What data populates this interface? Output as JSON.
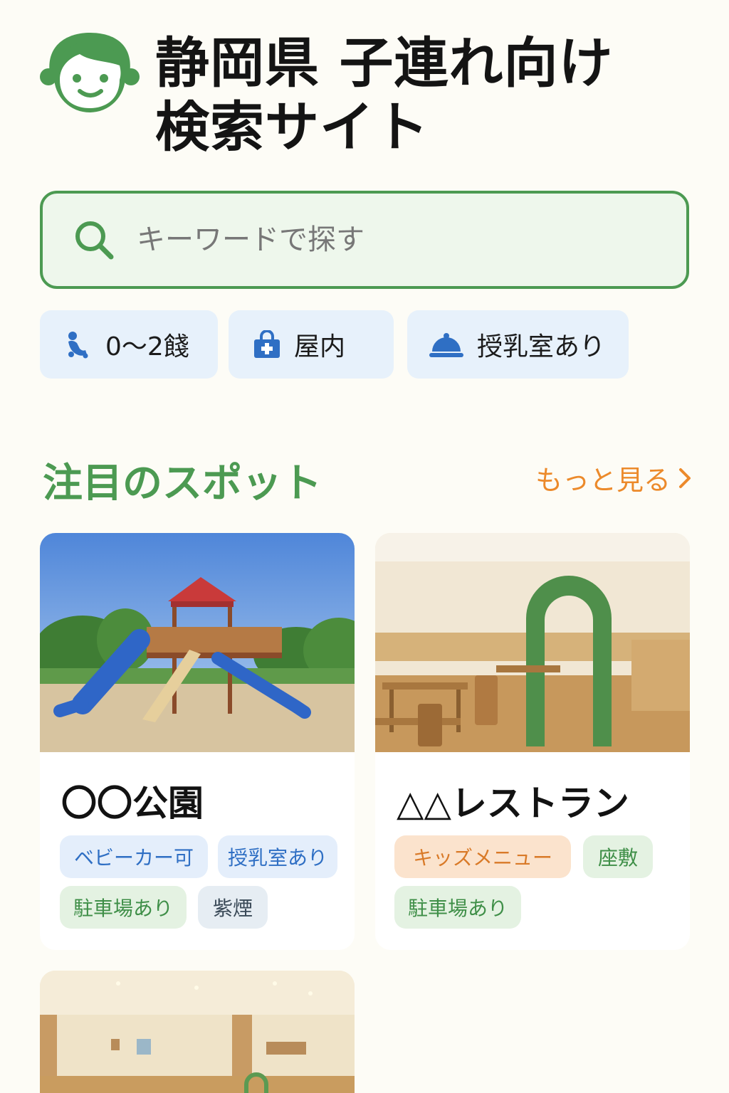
{
  "header": {
    "title_line1": "静岡県 子連れ向け",
    "title_line2": "検索サイト"
  },
  "search": {
    "placeholder": "キーワードで探す"
  },
  "filters": [
    {
      "label": "0〜2餞",
      "icon": "baby-crawling-icon"
    },
    {
      "label": "屋内",
      "icon": "building-plus-icon"
    },
    {
      "label": "授乳室あり",
      "icon": "cloche-icon"
    }
  ],
  "section": {
    "title": "注目のスポット",
    "more_label": "もっと見る"
  },
  "spots": [
    {
      "name": "〇〇公園",
      "tags": [
        "ベビーカー可",
        "授乳室あり",
        "駐車場あり",
        "紫煙"
      ]
    },
    {
      "name": "△△レストラン",
      "tags": [
        "キッズメニュー",
        "座敷",
        "駐車場あり"
      ]
    }
  ],
  "colors": {
    "brand_green": "#4c9a52",
    "accent_orange": "#ec8a2b",
    "chip_blue": "#e7f1fb",
    "background": "#fdfcf6"
  }
}
